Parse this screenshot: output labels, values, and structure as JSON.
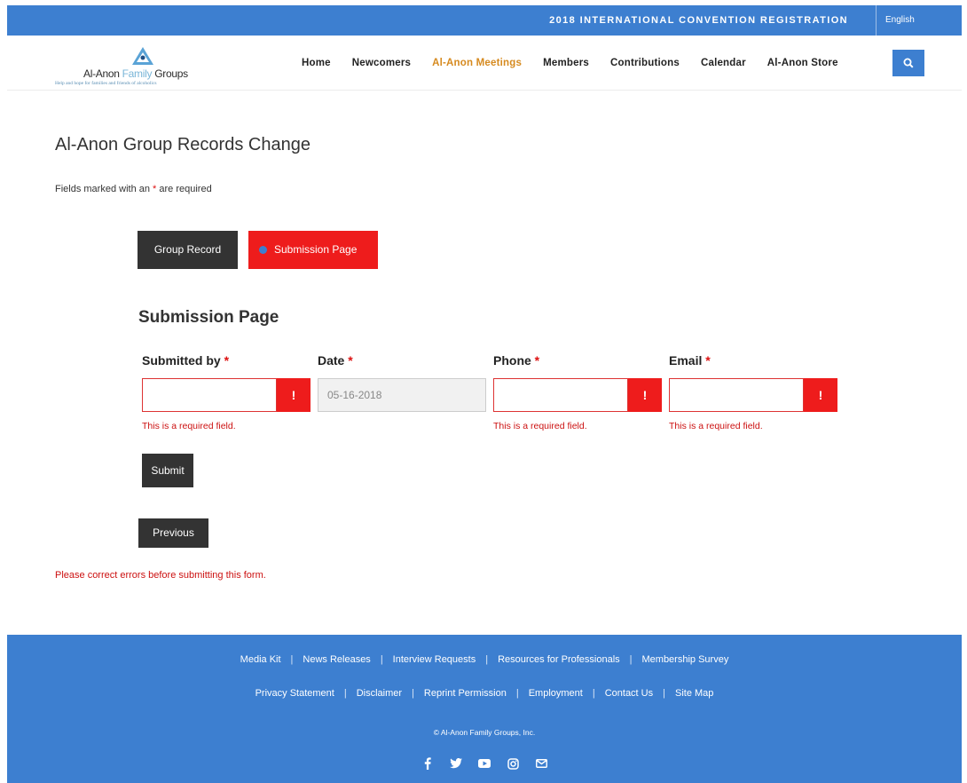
{
  "topbar": {
    "convention_link": "2018 INTERNATIONAL CONVENTION REGISTRATION",
    "language": "English"
  },
  "logo": {
    "name_part1": "Al-Anon ",
    "name_part2": "Family",
    "name_part3": " Groups",
    "tagline": "Help and hope for families and friends of alcoholics"
  },
  "nav": {
    "items": [
      {
        "label": "Home"
      },
      {
        "label": "Newcomers"
      },
      {
        "label": "Al-Anon Meetings"
      },
      {
        "label": "Members"
      },
      {
        "label": "Contributions"
      },
      {
        "label": "Calendar"
      },
      {
        "label": "Al-Anon Store"
      }
    ],
    "active_color": "#d68a1f"
  },
  "main": {
    "title": "Al-Anon Group Records Change",
    "required_note_prefix": "Fields marked with an ",
    "required_note_star": "*",
    "required_note_suffix": " are required",
    "tabs": [
      {
        "label": "Group Record"
      },
      {
        "label": "Submission Page"
      }
    ],
    "section_title": "Submission Page",
    "fields": {
      "submitted_by": {
        "label": "Submitted by",
        "value": "",
        "error": "This is a required field."
      },
      "date": {
        "label": "Date",
        "value": "05-16-2018"
      },
      "phone": {
        "label": "Phone",
        "value": "",
        "error": "This is a required field."
      },
      "email": {
        "label": "Email",
        "value": "",
        "error": "This is a required field."
      }
    },
    "required_star": "*",
    "error_icon": "!",
    "submit_label": "Submit",
    "previous_label": "Previous",
    "form_error": "Please correct errors before submitting this form."
  },
  "footer": {
    "row1": [
      "Media Kit",
      "News Releases",
      "Interview Requests",
      "Resources for Professionals",
      "Membership Survey"
    ],
    "row2": [
      "Privacy Statement",
      "Disclaimer",
      "Reprint Permission",
      "Employment",
      "Contact Us",
      "Site Map"
    ],
    "separator": "|",
    "copyright": "© Al-Anon Family Groups, Inc.",
    "social_icons": [
      "facebook-icon",
      "twitter-icon",
      "youtube-icon",
      "instagram-icon",
      "email-icon"
    ]
  },
  "colors": {
    "brand_blue": "#3d7fd0",
    "error_red": "#ee1c1c",
    "dark_button": "#333333"
  }
}
